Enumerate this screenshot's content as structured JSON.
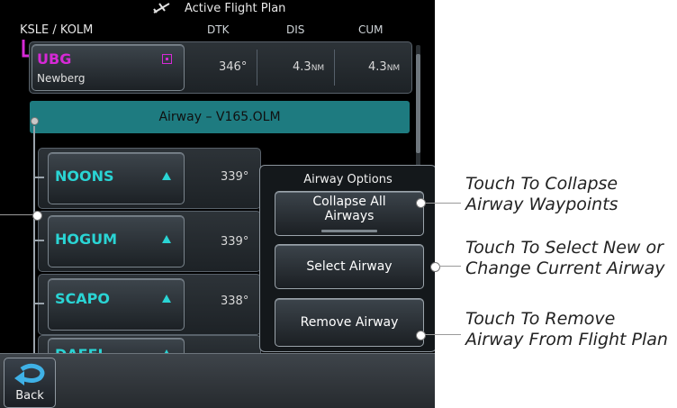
{
  "title_bar": {
    "title": "Active Flight Plan",
    "icon": "airplane-icon"
  },
  "header": {
    "route": "KSLE / KOLM",
    "col_dtk": "DTK",
    "col_dis": "DIS",
    "col_cum": "CUM"
  },
  "active_leg": {
    "ident": "UBG",
    "name": "Newberg",
    "dtk": "346°",
    "dis": "4.3",
    "dis_unit": "NM",
    "cum": "4.3",
    "cum_unit": "NM"
  },
  "airway": {
    "label": "Airway – V165.OLM"
  },
  "waypoints": [
    {
      "ident": "NOONS",
      "dtk": "339°"
    },
    {
      "ident": "HOGUM",
      "dtk": "339°"
    },
    {
      "ident": "SCAPO",
      "dtk": "338°"
    },
    {
      "ident": "DAFFI"
    }
  ],
  "airway_options": {
    "title": "Airway Options",
    "collapse_line1": "Collapse All",
    "collapse_line2": "Airways",
    "select": "Select Airway",
    "remove": "Remove Airway"
  },
  "bottom": {
    "back": "Back"
  },
  "callouts": {
    "collapse_1": "Touch To Collapse",
    "collapse_2": "Airway Waypoints",
    "select_1": "Touch To Select New or",
    "select_2": "Change Current Airway",
    "remove_1": "Touch To Remove",
    "remove_2": "Airway From Flight Plan"
  },
  "colors": {
    "active_magenta": "#d629d6",
    "waypoint_cyan": "#2ad4d4",
    "airway_teal": "#1e7b80"
  }
}
